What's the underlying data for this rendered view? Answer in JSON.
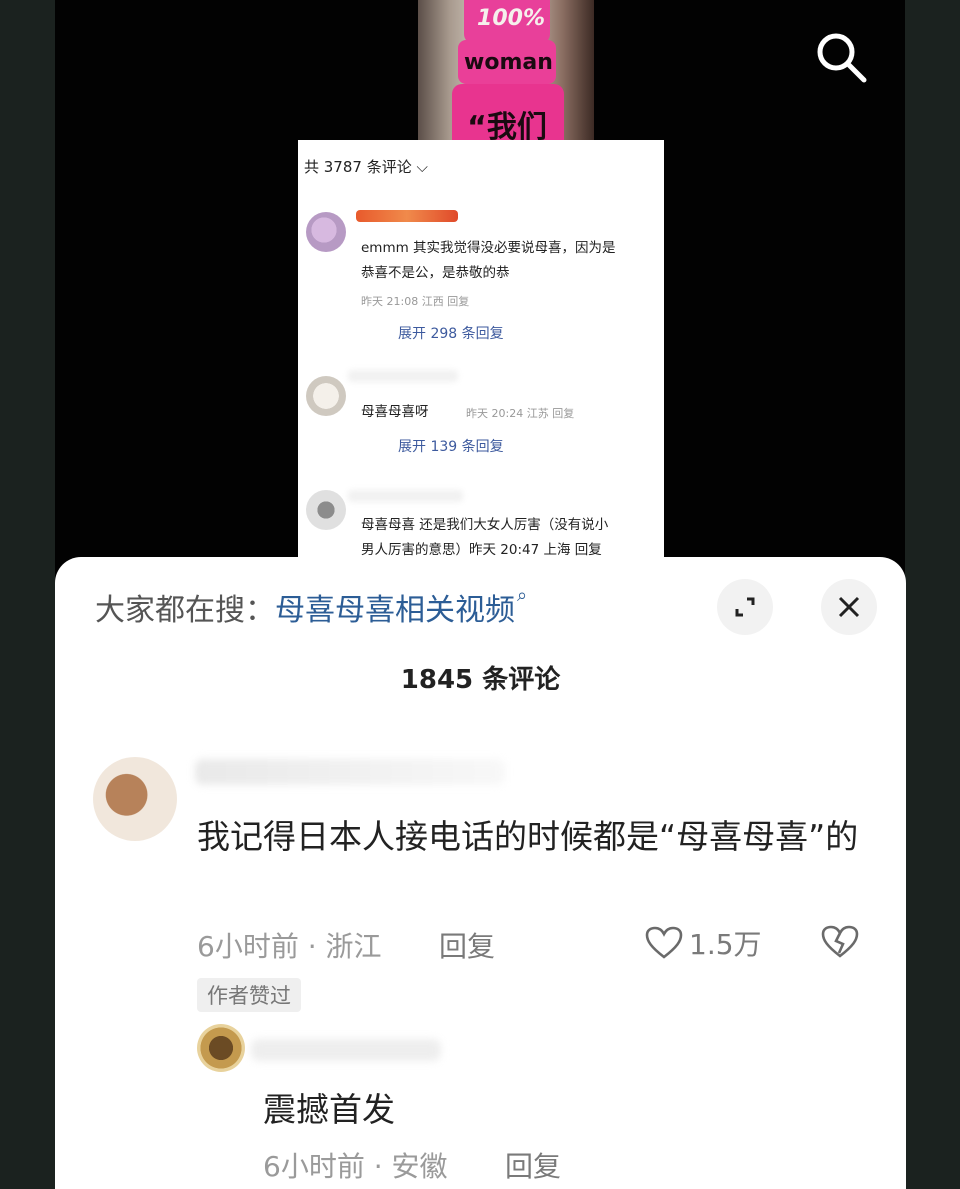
{
  "icons": {
    "search": "search-icon",
    "expand": "expand-icon",
    "close": "close-icon",
    "like": "heart-icon",
    "dislike": "broken-heart-icon"
  },
  "video_thumbnail": {
    "cake_text_top": "100%",
    "cake_text_mid": "woman",
    "cake_text_bottom": "“我们"
  },
  "embedded": {
    "count_label": "共 3787 条评论 ⌵",
    "comments": [
      {
        "text_line1": "emmm 其实我觉得没必要说母喜，因为是",
        "text_line2": "恭喜不是公，是恭敬的恭",
        "meta": "昨天 21:08 江西 回复",
        "expand": "展开 298 条回复"
      },
      {
        "text_line1": "母喜母喜呀",
        "meta": "昨天 20:24 江苏 回复",
        "expand": "展开 139 条回复"
      },
      {
        "text_line1": "母喜母喜 还是我们大女人厉害（没有说小",
        "text_line2": "男人厉害的意思）昨天 20:47 上海 回复"
      }
    ]
  },
  "sheet": {
    "search_hint_prefix": "大家都在搜：",
    "search_hint_link": "母喜母喜相关视频",
    "title": "1845 条评论",
    "comment": {
      "text": "我记得日本人接电话的时候都是“母喜母喜”的",
      "time_location": "6小时前 · 浙江",
      "reply": "回复",
      "likes": "1.5万",
      "badge": "作者赞过"
    },
    "reply_comment": {
      "text": "震撼首发",
      "time_location": "6小时前 · 安徽",
      "reply": "回复"
    }
  }
}
